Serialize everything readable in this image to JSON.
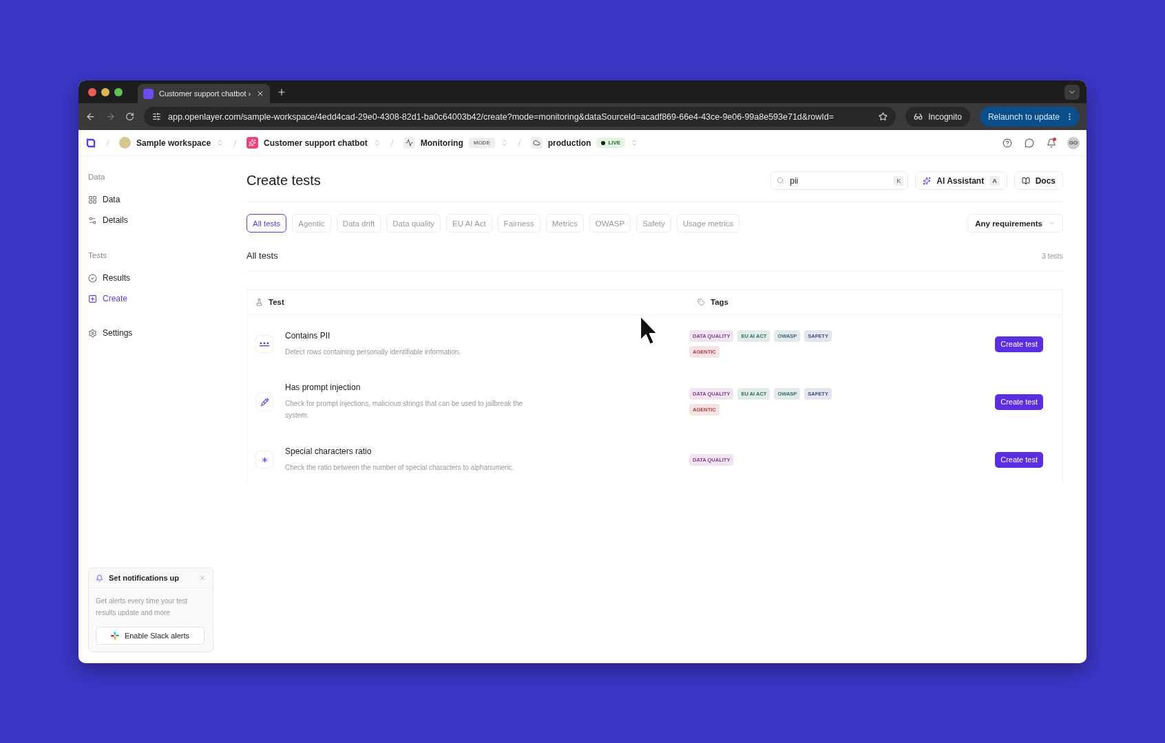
{
  "browser": {
    "tab_title": "Customer support chatbot ›",
    "url": "app.openlayer.com/sample-workspace/4edd4cad-29e0-4308-82d1-ba0c64003b42/create?mode=monitoring&dataSourceId=acadf869-66e4-43ce-9e06-99a8e593e71d&rowId=",
    "incognito": "Incognito",
    "relaunch": "Relaunch to update"
  },
  "breadcrumbs": [
    {
      "kind": "workspace",
      "label": "Sample workspace"
    },
    {
      "kind": "project",
      "label": "Customer support chatbot"
    },
    {
      "kind": "mode",
      "label": "Monitoring",
      "badge": "MODE"
    },
    {
      "kind": "env",
      "label": "production",
      "badge": "LIVE"
    }
  ],
  "header": {
    "has_notification": true,
    "avatar": "GO"
  },
  "sidebar": [
    {
      "title": "Data",
      "items": [
        {
          "label": "Data",
          "selected": false
        },
        {
          "label": "Details",
          "selected": false
        }
      ]
    },
    {
      "title": "Tests",
      "items": [
        {
          "label": "Results",
          "selected": false
        },
        {
          "label": "Create",
          "selected": true
        }
      ]
    },
    {
      "items": [
        {
          "label": "Settings",
          "selected": false
        }
      ]
    }
  ],
  "page_title": "Create tests",
  "search": {
    "value": "pii",
    "shortcut": "K"
  },
  "ai_assistant": {
    "label": "AI Assistant",
    "shortcut": "A"
  },
  "docs": "Docs",
  "filters": [
    {
      "label": "All tests",
      "selected": true
    },
    {
      "label": "Agentic",
      "selected": false
    },
    {
      "label": "Data drift",
      "selected": false
    },
    {
      "label": "Data quality",
      "selected": false
    },
    {
      "label": "EU AI Act",
      "selected": false
    },
    {
      "label": "Fairness",
      "selected": false
    },
    {
      "label": "Metrics",
      "selected": false
    },
    {
      "label": "OWASP",
      "selected": false
    },
    {
      "label": "Safety",
      "selected": false
    },
    {
      "label": "Usage metrics",
      "selected": false
    }
  ],
  "requirements": "Any requirements",
  "section_title": "All tests",
  "count": "3 tests",
  "columns": [
    "Test",
    "Tags"
  ],
  "rows": [
    {
      "name": "Contains PII",
      "description": "Detect rows containing personally identifiable information.",
      "tags": [
        {
          "label": "DATA QUALITY",
          "color": "#8a3f8c"
        },
        {
          "label": "EU AI ACT",
          "color": "#2f6f60"
        },
        {
          "label": "OWASP",
          "color": "#3a6b73"
        },
        {
          "label": "SAFETY",
          "color": "#3f4f86"
        },
        {
          "label": "AGENTIC",
          "color": "#b0403f"
        }
      ],
      "action": "Create test"
    },
    {
      "name": "Has prompt injection",
      "description": "Check for prompt injections, malicious strings that can be used to jailbreak the system.",
      "tags": [
        {
          "label": "DATA QUALITY",
          "color": "#8a3f8c"
        },
        {
          "label": "EU AI ACT",
          "color": "#2f6f60"
        },
        {
          "label": "OWASP",
          "color": "#3a6b73"
        },
        {
          "label": "SAFETY",
          "color": "#3f4f86"
        },
        {
          "label": "AGENTIC",
          "color": "#b0403f"
        }
      ],
      "action": "Create test"
    },
    {
      "name": "Special characters ratio",
      "description": "Check the ratio between the number of special characters to alphanumeric.",
      "tags": [
        {
          "label": "DATA QUALITY",
          "color": "#8a3f8c"
        }
      ],
      "action": "Create test"
    }
  ],
  "notification": {
    "title": "Set notifications up",
    "body": "Get alerts every time your test results update and more",
    "button": "Enable Slack alerts"
  }
}
